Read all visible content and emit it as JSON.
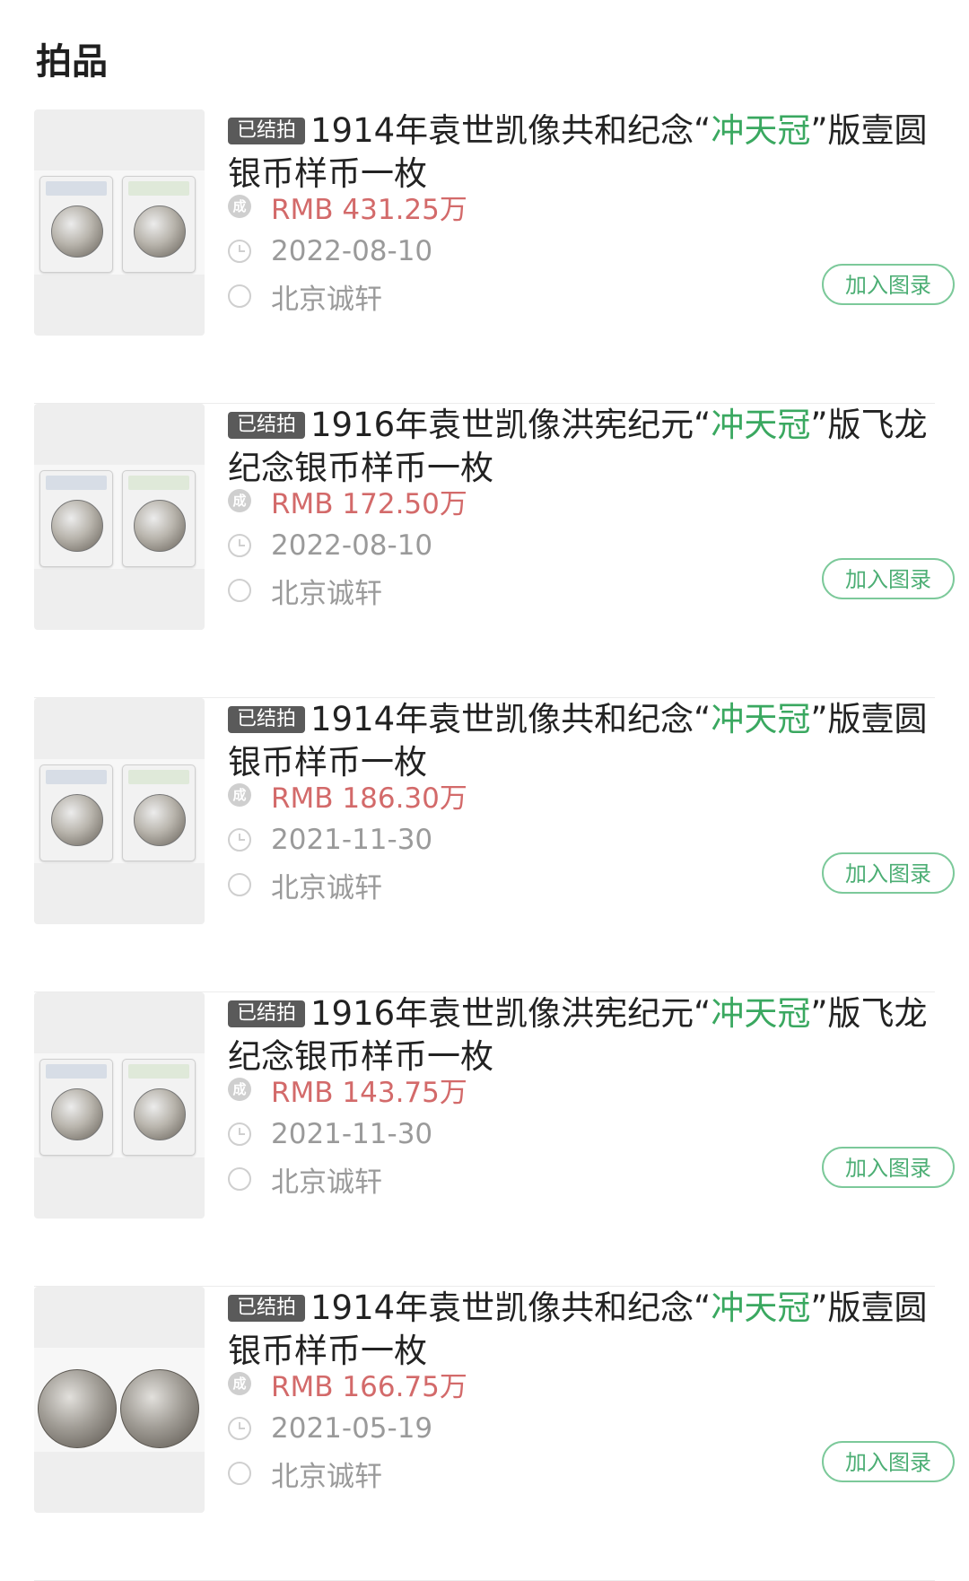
{
  "header": {
    "title": "拍品"
  },
  "items": [
    {
      "tag": "已结拍",
      "title_pre": "1914年袁世凯像共和纪念“",
      "title_hl": "冲天冠",
      "title_post": "”版壹圆银币样币一枚",
      "deal_icon": "成",
      "price": "RMB 431.25万",
      "date": "2022-08-10",
      "auction_house": "北京诚轩",
      "add_label": "加入图录"
    },
    {
      "tag": "已结拍",
      "title_pre": "1916年袁世凯像洪宪纪元“",
      "title_hl": "冲天冠",
      "title_post": "”版飞龙纪念银币样币一枚",
      "deal_icon": "成",
      "price": "RMB 172.50万",
      "date": "2022-08-10",
      "auction_house": "北京诚轩",
      "add_label": "加入图录"
    },
    {
      "tag": "已结拍",
      "title_pre": "1914年袁世凯像共和纪念“",
      "title_hl": "冲天冠",
      "title_post": "”版壹圆银币样币一枚",
      "deal_icon": "成",
      "price": "RMB 186.30万",
      "date": "2021-11-30",
      "auction_house": "北京诚轩",
      "add_label": "加入图录"
    },
    {
      "tag": "已结拍",
      "title_pre": "1916年袁世凯像洪宪纪元“",
      "title_hl": "冲天冠",
      "title_post": "”版飞龙纪念银币样币一枚",
      "deal_icon": "成",
      "price": "RMB 143.75万",
      "date": "2021-11-30",
      "auction_house": "北京诚轩",
      "add_label": "加入图录"
    },
    {
      "tag": "已结拍",
      "title_pre": "1914年袁世凯像共和纪念“",
      "title_hl": "冲天冠",
      "title_post": "”版壹圆银币样币一枚",
      "deal_icon": "成",
      "price": "RMB 166.75万",
      "date": "2021-05-19",
      "auction_house": "北京诚轩",
      "add_label": "加入图录"
    }
  ],
  "colors": {
    "tag_bg": "#5a5a5a",
    "highlight": "#3aa860",
    "price": "#d36a6a",
    "button": "#4cae74"
  },
  "icons": {
    "deal": "deal-badge-icon",
    "date": "clock-icon",
    "house": "circle-icon"
  }
}
